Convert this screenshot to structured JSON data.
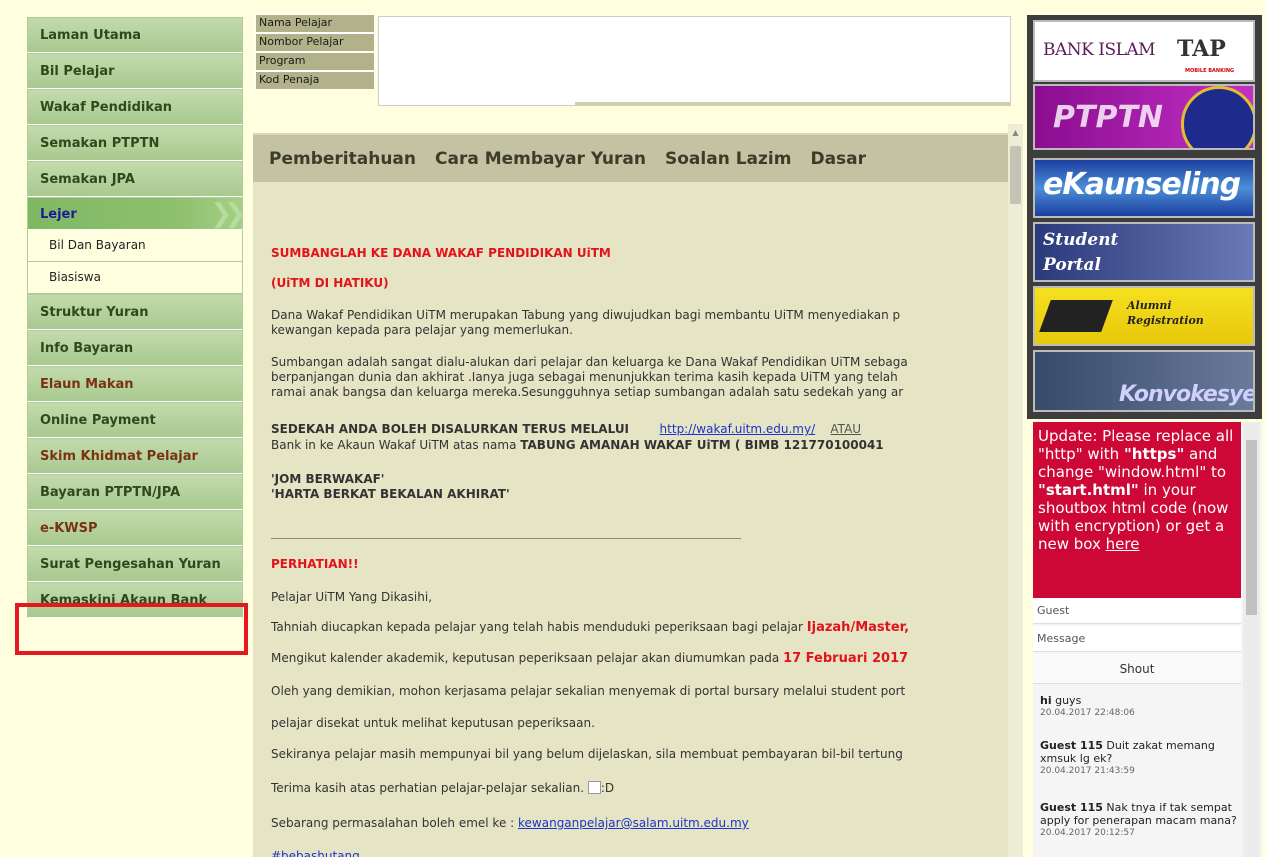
{
  "sidebar": {
    "items": [
      {
        "label": "Laman Utama"
      },
      {
        "label": "Bil Pelajar"
      },
      {
        "label": "Wakaf Pendidikan"
      },
      {
        "label": "Semakan PTPTN"
      },
      {
        "label": "Semakan JPA"
      },
      {
        "label": "Lejer"
      },
      {
        "label": "Struktur Yuran"
      },
      {
        "label": "Info Bayaran"
      },
      {
        "label": "Elaun Makan"
      },
      {
        "label": "Online Payment"
      },
      {
        "label": "Skim Khidmat Pelajar"
      },
      {
        "label": "Bayaran PTPTN/JPA"
      },
      {
        "label": "e-KWSP"
      },
      {
        "label": "Surat Pengesahan Yuran"
      },
      {
        "label": "Kemaskini Akaun Bank"
      }
    ],
    "sub_items": [
      {
        "label": "Bil Dan Bayaran"
      },
      {
        "label": "Biasiswa"
      }
    ]
  },
  "info": {
    "labels": [
      "Nama Pelajar",
      "Nombor Pelajar",
      "Program",
      "Kod Penaja"
    ]
  },
  "tabs": [
    "Pemberitahuan",
    "Cara Membayar Yuran",
    "Soalan Lazim",
    "Dasar"
  ],
  "content": {
    "heading1": "SUMBANGLAH KE DANA  WAKAF PENDIDIKAN UiTM",
    "heading2": "(UiTM DI HATIKU)",
    "para1_l1": "Dana Wakaf Pendidikan UiTM merupakan Tabung yang diwujudkan bagi membantu UiTM menyediakan p",
    "para1_l2": "kewangan kepada para pelajar yang memerlukan.",
    "para2_l1": "Sumbangan adalah sangat dialu-alukan dari pelajar dan keluarga ke Dana Wakaf Pendidikan UiTM sebaga",
    "para2_l2": "berpanjangan dunia dan akhirat .Ianya juga sebagai menunjukkan terima kasih kepada UiTM yang telah",
    "para2_l3": "ramai anak bangsa dan keluarga mereka.Sesungguhnya setiap sumbangan adalah satu sedekah yang ar",
    "sedekah_text": "SEDEKAH ANDA BOLEH DISALURKAN TERUS MELALUI",
    "wakaf_link": "http://wakaf.uitm.edu.my/",
    "atau": "ATAU",
    "bank_prefix": "Bank in ke Akaun Wakaf UiTM atas nama ",
    "bank_bold": "TABUNG AMANAH WAKAF UiTM  ( BIMB 121770100041",
    "quote1": "'JOM BERWAKAF'",
    "quote2": "'HARTA BERKAT BEKALAN AKHIRAT'",
    "perhatian": "PERHATIAN!!",
    "salam": "Pelajar UiTM Yang Dikasihi,",
    "tahniah_prefix": "Tahniah diucapkan kepada pelajar yang telah habis menduduki peperiksaan bagi pelajar ",
    "tahniah_red": "Ijazah/Master,",
    "kalender_prefix": "Mengikut kalender akademik, keputusan peperiksaan pelajar akan diumumkan pada ",
    "kalender_red": "17 Februari 2017",
    "oleh": "Oleh yang demikian, mohon kerjasama pelajar sekalian menyemak di portal bursary melalui student port",
    "disekat": "pelajar disekat untuk melihat keputusan peperiksaan.",
    "sekiranya": "Sekiranya pelajar masih mempunyai bil yang belum dijelaskan, sila membuat pembayaran bil-bil tertung",
    "terima": "Terima kasih atas perhatian pelajar-pelajar sekalian.",
    "terima_suffix": ":D",
    "emel_prefix": "Sebarang permasalahan boleh emel ke : ",
    "emel_link": "kewanganpelajar@salam.uitm.edu.my",
    "hashtag": "#bebashutang"
  },
  "banners": {
    "bank_islam": "BANK ISLAM",
    "tap": "TAP",
    "tap_sub": "MOBILE BANKING",
    "ptptn": "PTPTN",
    "ekaunseling": "eKaunseling",
    "student_portal_1": "Student",
    "student_portal_2": "Portal",
    "alumni_1": "Alumni",
    "alumni_2": "Registration",
    "konvokesyen": "Konvokesyen"
  },
  "shoutbox": {
    "update_1": "Update: Please replace all \"http\" with ",
    "update_https": "\"https\"",
    "update_2": " and change \"window.html\" to ",
    "update_start": "\"start.html\"",
    "update_3": " in your shoutbox html code (now with encryption) or get a new box ",
    "update_here": "here",
    "guest_placeholder": "Guest",
    "message_placeholder": "Message",
    "shout_button": "Shout",
    "messages": [
      {
        "name": "hi",
        "text": " guys",
        "time": "20.04.2017 22:48:06"
      },
      {
        "name": "Guest 115",
        "text": " Duit zakat memang xmsuk lg ek?",
        "time": "20.04.2017 21:43:59"
      },
      {
        "name": "Guest 115",
        "text": " Nak tnya if tak sempat apply for penerapan macam mana?",
        "time": "20.04.2017 20:12:57"
      }
    ]
  }
}
